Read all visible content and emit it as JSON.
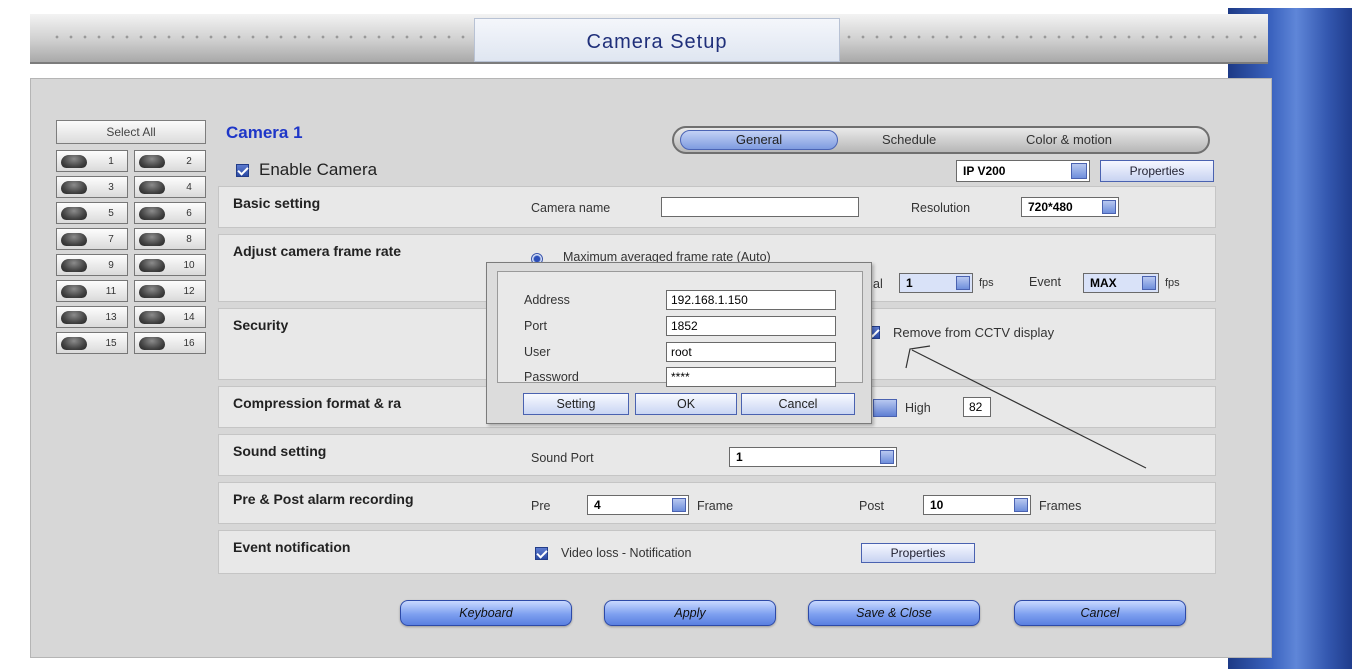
{
  "window": {
    "title": "Camera Setup"
  },
  "camera_list": {
    "select_all_label": "Select All",
    "cameras": [
      "1",
      "2",
      "3",
      "4",
      "5",
      "6",
      "7",
      "8",
      "9",
      "10",
      "11",
      "12",
      "13",
      "14",
      "15",
      "16"
    ]
  },
  "camera": {
    "title": "Camera 1",
    "enable_label": "Enable Camera",
    "enabled": true
  },
  "tabs": {
    "general": "General",
    "schedule": "Schedule",
    "color_motion": "Color & motion",
    "active": "General"
  },
  "model": {
    "selected": "IP V200",
    "properties_label": "Properties"
  },
  "basic": {
    "label": "Basic setting",
    "camera_name_label": "Camera name",
    "camera_name_value": "",
    "resolution_label": "Resolution",
    "resolution_value": "720*480"
  },
  "frame_rate": {
    "label": "Adjust camera frame rate",
    "auto_option": "Maximum averaged frame rate (Auto)",
    "normal_partial": "al",
    "normal_value": "1",
    "fps_label": "fps",
    "event_label": "Event",
    "event_value": "MAX",
    "event_fps_label": "fps"
  },
  "security": {
    "label": "Security",
    "remove_cctv_label": "Remove from CCTV display"
  },
  "compression": {
    "label": "Compression format & ra",
    "high_label": "High",
    "high_value": "82"
  },
  "sound": {
    "label": "Sound setting",
    "port_label": "Sound Port",
    "port_value": "1"
  },
  "alarm": {
    "label": "Pre & Post alarm recording",
    "pre_label": "Pre",
    "pre_value": "4",
    "pre_unit": "Frame",
    "post_label": "Post",
    "post_value": "10",
    "post_unit": "Frames"
  },
  "event_notification": {
    "label": "Event notification",
    "video_loss_label": "Video loss - Notification",
    "video_loss_checked": true,
    "properties_label": "Properties"
  },
  "modal": {
    "address_label": "Address",
    "address_value": "192.168.1.150",
    "port_label": "Port",
    "port_value": "1852",
    "user_label": "User",
    "user_value": "root",
    "password_label": "Password",
    "password_value": "****",
    "setting_label": "Setting",
    "ok_label": "OK",
    "cancel_label": "Cancel"
  },
  "footer": {
    "keyboard_label": "Keyboard",
    "apply_label": "Apply",
    "save_close_label": "Save & Close",
    "cancel_label": "Cancel"
  },
  "colors": {
    "accent_blue": "#1e36c8",
    "button_blue": "#7ea0f0",
    "panel_gray": "#d7d7d7"
  }
}
